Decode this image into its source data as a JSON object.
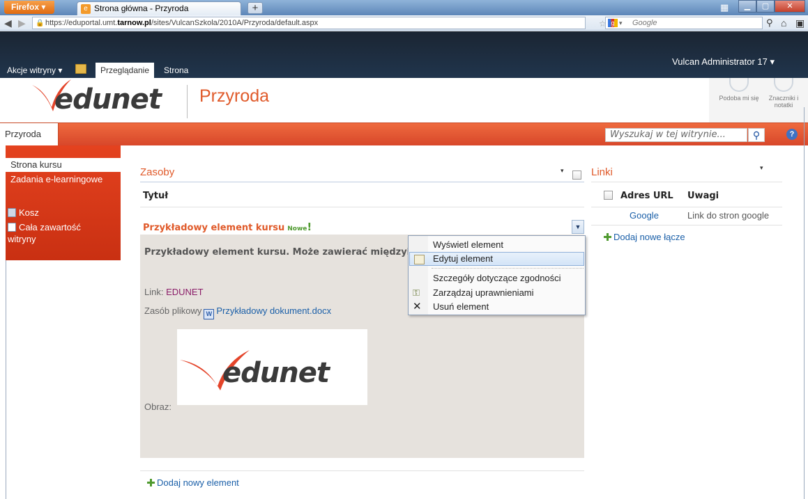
{
  "browser": {
    "menu_button": "Firefox",
    "tab_title": "Strona główna - Przyroda",
    "new_tab": "+",
    "url_prefix": "https://eduportal.umt.",
    "url_domain": "tarnow.pl",
    "url_suffix": "/sites/VulcanSzkola/2010A/Przyroda/default.aspx",
    "search_engine": "Google"
  },
  "ribbon": {
    "user": "Vulcan Administrator 17 ▾",
    "site_actions": "Akcje witryny ▾",
    "tab_browse": "Przeglądanie",
    "tab_page": "Strona"
  },
  "header": {
    "logo_text": "edunet",
    "site_title": "Przyroda",
    "tool_like": "Podoba mi się",
    "tool_tags": "Znaczniki i notatki"
  },
  "topnav": {
    "home": "Przyroda",
    "search_placeholder": "Wyszukaj w tej witrynie..."
  },
  "leftnav": {
    "items": [
      {
        "label": "Strona kursu"
      },
      {
        "label": "Zadania e-learningowe"
      }
    ],
    "recycle_bin": "Kosz",
    "all_content_1": "Cała zawartość",
    "all_content_2": "witryny"
  },
  "resources": {
    "title": "Zasoby",
    "column_title": "Tytuł",
    "item_title": "Przykładowy element kursu",
    "new_badge": "Nowe",
    "description": "Przykładowy element kursu. Może zawierać międzyinnymi:",
    "link_label": "Link:",
    "link_value": "EDUNET",
    "file_label": "Zasób plikowy",
    "file_name": "Przykładowy dokument.docx",
    "image_label": "Obraz:",
    "image_logo_text": "edunet",
    "add_new": "Dodaj nowy element"
  },
  "context_menu": {
    "items": [
      {
        "label": "Wyświetl element"
      },
      {
        "label": "Edytuj element"
      },
      {
        "label": "Szczegóły dotyczące zgodności"
      },
      {
        "label": "Zarządzaj uprawnieniami"
      },
      {
        "label": "Usuń element"
      }
    ]
  },
  "links": {
    "title": "Linki",
    "col_url": "Adres URL",
    "col_notes": "Uwagi",
    "rows": [
      {
        "url": "Google",
        "notes": "Link do stron google"
      }
    ],
    "add_new": "Dodaj nowe łącze"
  },
  "colors": {
    "brand_orange": "#e05a2a",
    "nav_red": "#d8472a",
    "link_blue": "#1a5fa8",
    "ribbon_dark": "#1b2532"
  }
}
